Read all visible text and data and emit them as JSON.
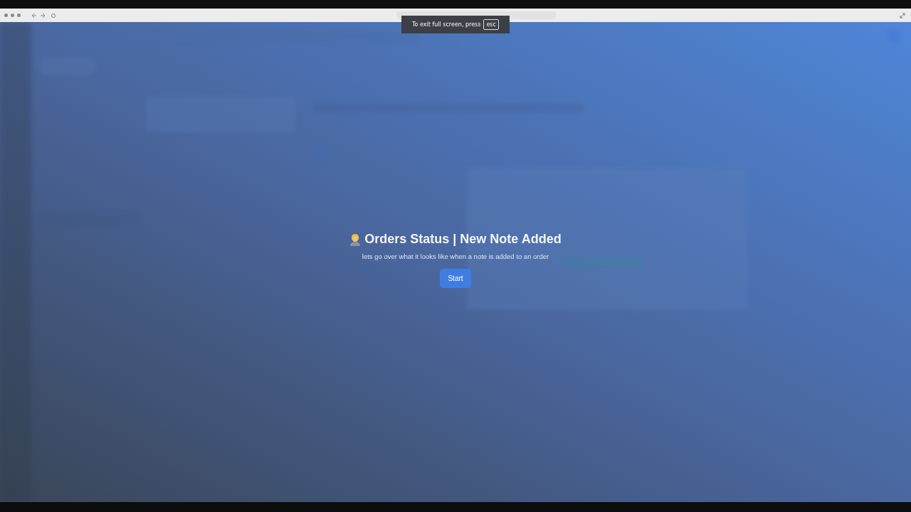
{
  "fullscreen_notice": {
    "text": "To exit full screen, press",
    "key": "esc"
  },
  "tour": {
    "title": "Orders Status | New Note Added",
    "subtitle": "lets go over what it looks like when a note is added to an order",
    "button": "Start"
  }
}
